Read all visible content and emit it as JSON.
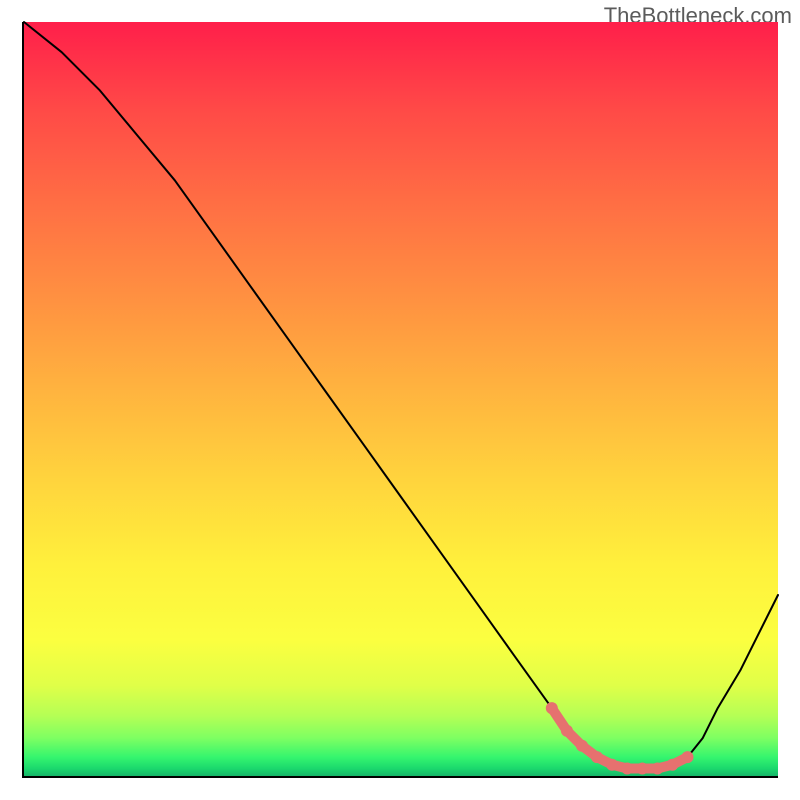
{
  "watermark": "TheBottleneck.com",
  "chart_data": {
    "type": "line",
    "title": "",
    "xlabel": "",
    "ylabel": "",
    "xlim": [
      0,
      100
    ],
    "ylim": [
      0,
      100
    ],
    "series": [
      {
        "name": "bottleneck-curve",
        "x": [
          0,
          5,
          10,
          15,
          20,
          25,
          30,
          35,
          40,
          45,
          50,
          55,
          60,
          65,
          70,
          72,
          74,
          76,
          78,
          80,
          82,
          84,
          86,
          88,
          90,
          92,
          95,
          100
        ],
        "y": [
          100,
          96,
          91,
          85,
          79,
          72,
          65,
          58,
          51,
          44,
          37,
          30,
          23,
          16,
          9,
          6,
          4,
          2.5,
          1.5,
          1,
          1,
          1,
          1.5,
          2.5,
          5,
          9,
          14,
          24
        ]
      }
    ],
    "highlight": {
      "name": "optimal-range",
      "x": [
        70,
        72,
        74,
        76,
        78,
        80,
        82,
        84,
        86,
        88
      ],
      "y": [
        9,
        6,
        4,
        2.5,
        1.5,
        1,
        1,
        1,
        1.5,
        2.5
      ]
    },
    "gradient": {
      "top_color": "#ff1f4a",
      "mid_colors": [
        "#ff8f41",
        "#ffd23d",
        "#fbff40"
      ],
      "bottom_color": "#16b669"
    }
  }
}
